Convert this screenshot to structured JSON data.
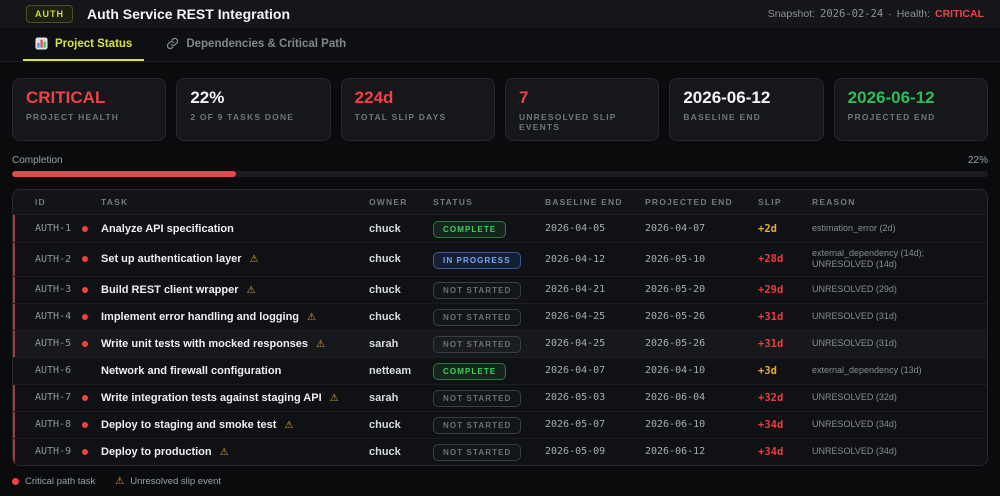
{
  "colors": {
    "accent": "#d9e23f",
    "red": "#ef4146",
    "amber": "#e8ab3a",
    "green": "#2ebd59",
    "blue": "#74a9f7"
  },
  "header": {
    "badge": "AUTH",
    "title": "Auth Service REST Integration",
    "snapshot_label": "Snapshot:",
    "snapshot_date": "2026-02-24",
    "separator": "·",
    "health_label": "Health:",
    "health_value": "CRITICAL"
  },
  "tabs": [
    {
      "label": "Project Status",
      "icon": "bar-chart-icon",
      "active": true
    },
    {
      "label": "Dependencies & Critical Path",
      "icon": "link-icon",
      "active": false
    }
  ],
  "stats": [
    {
      "value": "CRITICAL",
      "label": "PROJECT HEALTH",
      "color": "#ef4146"
    },
    {
      "value": "22%",
      "label": "2 OF 9 TASKS DONE",
      "color": "#f5f6f7"
    },
    {
      "value": "224d",
      "label": "TOTAL SLIP DAYS",
      "color": "#ef4146"
    },
    {
      "value": "7",
      "label": "UNRESOLVED SLIP EVENTS",
      "color": "#ef4146"
    },
    {
      "value": "2026-06-12",
      "label": "BASELINE END",
      "color": "#f5f6f7"
    },
    {
      "value": "2026-06-12",
      "label": "PROJECTED END",
      "color": "#2ebd59"
    }
  ],
  "progress": {
    "label": "Completion",
    "value_label": "22%",
    "percent": 23
  },
  "table": {
    "columns": [
      "ID",
      "TASK",
      "OWNER",
      "STATUS",
      "BASELINE END",
      "PROJECTED END",
      "SLIP",
      "REASON"
    ],
    "rows": [
      {
        "id": "AUTH-1",
        "critical": true,
        "task": "Analyze API specification",
        "warning": false,
        "owner": "chuck",
        "status_label": "COMPLETE",
        "status_type": "complete",
        "baseline": "2026-04-05",
        "projected": "2026-04-07",
        "slip": "+2d",
        "slip_level": "warn",
        "reason": "estimation_error (2d)",
        "highlighted": false
      },
      {
        "id": "AUTH-2",
        "critical": true,
        "task": "Set up authentication layer",
        "warning": true,
        "owner": "chuck",
        "status_label": "IN PROGRESS",
        "status_type": "in-progress",
        "baseline": "2026-04-12",
        "projected": "2026-05-10",
        "slip": "+28d",
        "slip_level": "danger",
        "reason": "external_dependency (14d); UNRESOLVED (14d)",
        "highlighted": false
      },
      {
        "id": "AUTH-3",
        "critical": true,
        "task": "Build REST client wrapper",
        "warning": true,
        "owner": "chuck",
        "status_label": "NOT STARTED",
        "status_type": "not-started",
        "baseline": "2026-04-21",
        "projected": "2026-05-20",
        "slip": "+29d",
        "slip_level": "danger",
        "reason": "UNRESOLVED (29d)",
        "highlighted": false
      },
      {
        "id": "AUTH-4",
        "critical": true,
        "task": "Implement error handling and logging",
        "warning": true,
        "owner": "chuck",
        "status_label": "NOT STARTED",
        "status_type": "not-started",
        "baseline": "2026-04-25",
        "projected": "2026-05-26",
        "slip": "+31d",
        "slip_level": "danger",
        "reason": "UNRESOLVED (31d)",
        "highlighted": false
      },
      {
        "id": "AUTH-5",
        "critical": true,
        "task": "Write unit tests with mocked responses",
        "warning": true,
        "owner": "sarah",
        "status_label": "NOT STARTED",
        "status_type": "not-started",
        "baseline": "2026-04-25",
        "projected": "2026-05-26",
        "slip": "+31d",
        "slip_level": "danger",
        "reason": "UNRESOLVED (31d)",
        "highlighted": true
      },
      {
        "id": "AUTH-6",
        "critical": false,
        "task": "Network and firewall configuration",
        "warning": false,
        "owner": "netteam",
        "status_label": "COMPLETE",
        "status_type": "complete",
        "baseline": "2026-04-07",
        "projected": "2026-04-10",
        "slip": "+3d",
        "slip_level": "warn",
        "reason": "external_dependency (13d)",
        "highlighted": false
      },
      {
        "id": "AUTH-7",
        "critical": true,
        "task": "Write integration tests against staging API",
        "warning": true,
        "owner": "sarah",
        "status_label": "NOT STARTED",
        "status_type": "not-started",
        "baseline": "2026-05-03",
        "projected": "2026-06-04",
        "slip": "+32d",
        "slip_level": "danger",
        "reason": "UNRESOLVED (32d)",
        "highlighted": false
      },
      {
        "id": "AUTH-8",
        "critical": true,
        "task": "Deploy to staging and smoke test",
        "warning": true,
        "owner": "chuck",
        "status_label": "NOT STARTED",
        "status_type": "not-started",
        "baseline": "2026-05-07",
        "projected": "2026-06-10",
        "slip": "+34d",
        "slip_level": "danger",
        "reason": "UNRESOLVED (34d)",
        "highlighted": false
      },
      {
        "id": "AUTH-9",
        "critical": true,
        "task": "Deploy to production",
        "warning": true,
        "owner": "chuck",
        "status_label": "NOT STARTED",
        "status_type": "not-started",
        "baseline": "2026-05-09",
        "projected": "2026-06-12",
        "slip": "+34d",
        "slip_level": "danger",
        "reason": "UNRESOLVED (34d)",
        "highlighted": false
      }
    ]
  },
  "legend": {
    "critical_label": "Critical path task",
    "unresolved_label": "Unresolved slip event",
    "warning_glyph": "⚠"
  }
}
